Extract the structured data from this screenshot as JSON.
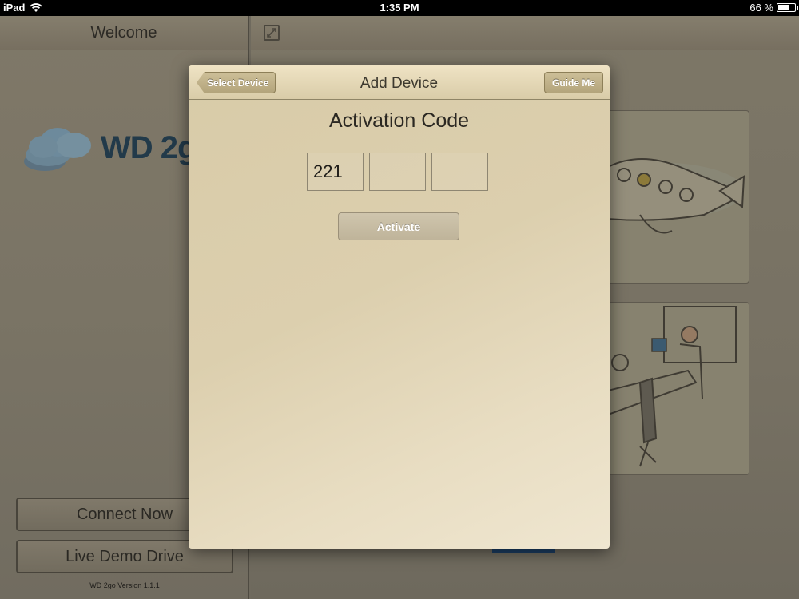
{
  "status_bar": {
    "device": "iPad",
    "time": "1:35 PM",
    "battery_percent": "66 %",
    "battery_level": 0.66
  },
  "left_pane": {
    "header_title": "Welcome",
    "logo_text": "WD 2go",
    "connect_label": "Connect Now",
    "demo_label": "Live Demo Drive",
    "version": "WD 2go  Version  1.1.1"
  },
  "modal": {
    "title": "Add Device",
    "back_label": "Select Device",
    "guide_label": "Guide Me",
    "heading": "Activation Code",
    "code_fields": [
      "221",
      "",
      ""
    ],
    "activate_label": "Activate"
  },
  "colors": {
    "accent_blue": "#1c3f66",
    "modal_bg": "#dccfae"
  }
}
